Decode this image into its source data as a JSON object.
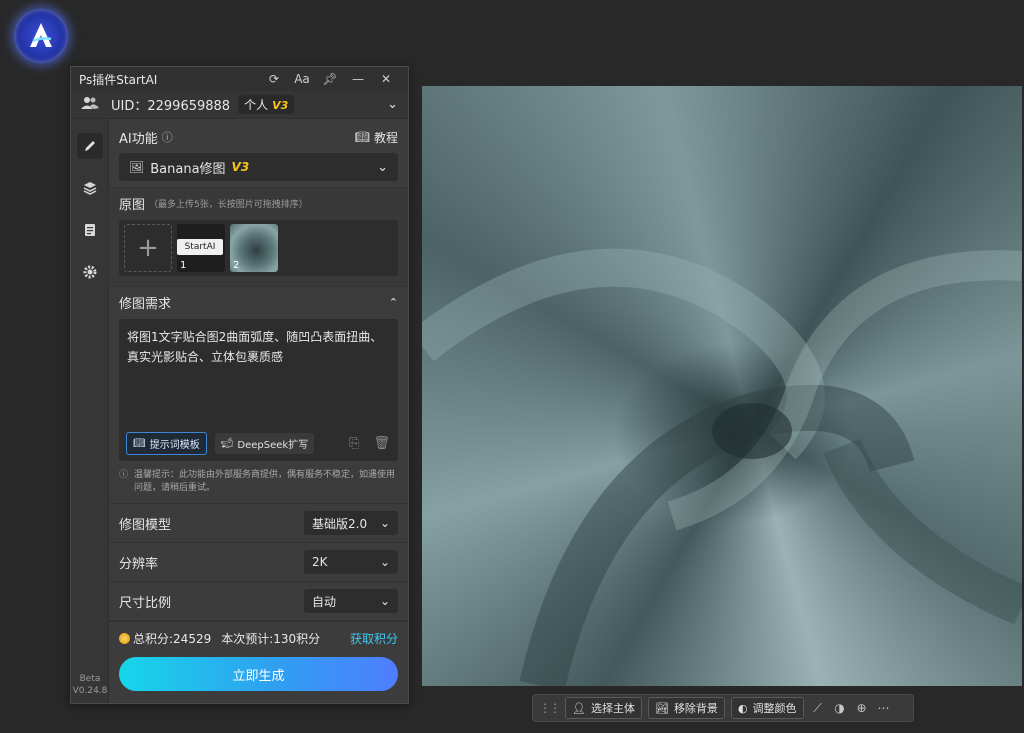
{
  "panel": {
    "title": "Ps插件StartAI",
    "title_buttons": [
      "refresh-icon",
      "font-size-icon",
      "pin-icon",
      "minimize-icon",
      "close-icon"
    ],
    "font_size_label": "Aa"
  },
  "user": {
    "uid": "UID：2299659888",
    "plan": "个人",
    "plan_version": "V3"
  },
  "ai_function": {
    "label": "AI功能",
    "tutorial": "教程",
    "selected": "Banana修图",
    "selected_version": "V3"
  },
  "source_images": {
    "label": "原图",
    "hint": "（最多上传5张，长按图片可拖拽排序）",
    "thumbnails": [
      {
        "label": "StartAI",
        "number": "1"
      },
      {
        "label": "",
        "number": "2"
      }
    ]
  },
  "requirement": {
    "label": "修图需求",
    "text": "将图1文字贴合图2曲面弧度、随凹凸表面扭曲、真实光影贴合、立体包裹质感",
    "prompt_template": "提示词模板",
    "deepseek": "DeepSeek扩写"
  },
  "notice": "温馨提示：此功能由外部服务商提供，偶有服务不稳定，如遇使用问题，请稍后重试。",
  "params": [
    {
      "label": "修图模型",
      "value": "基础版2.0"
    },
    {
      "label": "分辨率",
      "value": "2K"
    },
    {
      "label": "尺寸比例",
      "value": "自动"
    }
  ],
  "footer": {
    "points": "总积分:24529",
    "estimate": "本次预计:130积分",
    "get_points": "获取积分",
    "generate": "立即生成"
  },
  "sidebar": {
    "items": [
      "brush-icon",
      "layers-icon",
      "document-icon",
      "gear-icon"
    ],
    "beta": "Beta",
    "version": "V0.24.8"
  },
  "float_toolbar": {
    "select_subject": "选择主体",
    "remove_bg": "移除背景",
    "adjust_color": "调整颜色"
  },
  "colors": {
    "accent_gradient_start": "#17d6ea",
    "accent_gradient_end": "#4f7dff",
    "version_tag": "#f5c518",
    "link": "#3ec8f0"
  }
}
